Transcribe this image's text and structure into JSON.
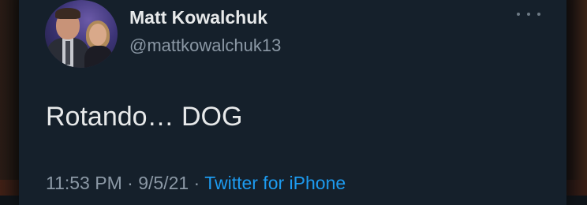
{
  "tweet": {
    "display_name": "Matt Kowalchuk",
    "handle": "@mattkowalchuk13",
    "text": "Rotando… DOG",
    "time": "11:53 PM",
    "separator1": " · ",
    "date": "9/5/21",
    "separator2": " · ",
    "source": "Twitter for iPhone",
    "more_icon": "more-horizontal-icon",
    "colors": {
      "background": "#15202b",
      "primary_text": "#e7e9ea",
      "secondary_text": "#8b98a5",
      "link": "#1d9bf0"
    }
  }
}
